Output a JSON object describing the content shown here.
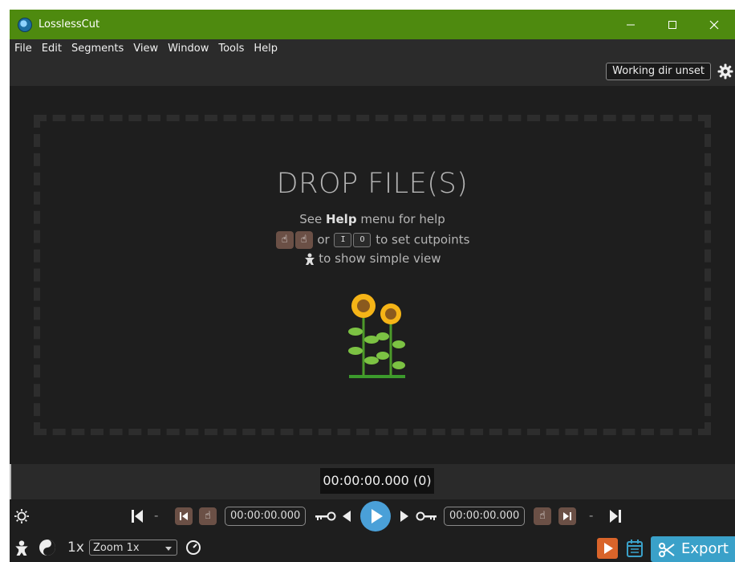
{
  "window": {
    "title": "LosslessCut"
  },
  "menu": [
    "File",
    "Edit",
    "Segments",
    "View",
    "Window",
    "Tools",
    "Help"
  ],
  "topbar": {
    "working_dir": "Working dir unset"
  },
  "drop": {
    "title": "DROP FILE(S)",
    "help_pre": "See ",
    "help_bold": "Help",
    "help_post": " menu for help",
    "or_text": "or",
    "key_in": "I",
    "key_out": "O",
    "cutpoints_text": "to set cutpoints",
    "simple_view_text": "to show simple view"
  },
  "timeline": {
    "current_time": "00:00:00.000 (0)"
  },
  "controls": {
    "start_time": "00:00:00.000",
    "end_time": "00:00:00.000",
    "dash": "-"
  },
  "bottom": {
    "speed": "1x",
    "zoom": "Zoom 1x",
    "export_label": "Export"
  },
  "colors": {
    "titlebar": "#4e8a0f",
    "background": "#1e1e1e",
    "accent": "#4aa0d8",
    "export": "#3aa1c9",
    "segment_button": "#6b5046",
    "orange": "#d9642a"
  }
}
